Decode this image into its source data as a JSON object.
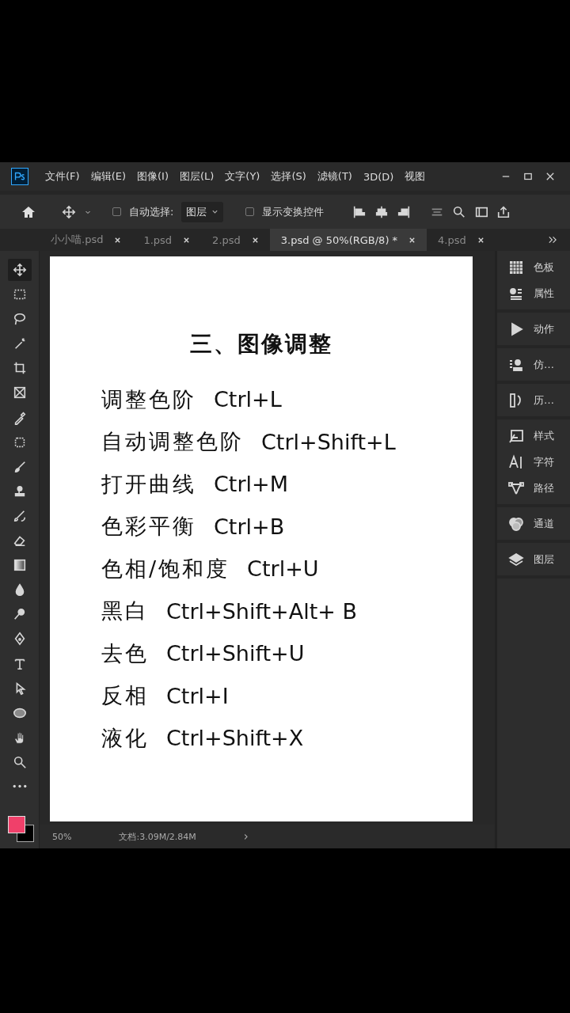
{
  "menu_bar": {
    "items": [
      "文件(F)",
      "编辑(E)",
      "图像(I)",
      "图层(L)",
      "文字(Y)",
      "选择(S)",
      "滤镜(T)",
      "3D(D)",
      "视图"
    ]
  },
  "options_bar": {
    "auto_select": {
      "label": "自动选择:",
      "checked": false
    },
    "target": {
      "value": "图层"
    },
    "show_transform": {
      "label": "显示变换控件",
      "checked": false
    }
  },
  "tabs": [
    {
      "label": "小小喵.psd",
      "selected": false
    },
    {
      "label": "1.psd",
      "selected": false
    },
    {
      "label": "2.psd",
      "selected": false
    },
    {
      "label": "3.psd @ 50%(RGB/8) *",
      "selected": true
    },
    {
      "label": "4.psd",
      "selected": false
    }
  ],
  "tools": [
    {
      "kind": "move",
      "selected": true
    },
    {
      "kind": "marquee",
      "selected": false
    },
    {
      "kind": "lasso",
      "selected": false
    },
    {
      "kind": "wand",
      "selected": false
    },
    {
      "kind": "crop",
      "selected": false
    },
    {
      "kind": "frame",
      "selected": false
    },
    {
      "kind": "eyedropper",
      "selected": false
    },
    {
      "kind": "patch",
      "selected": false
    },
    {
      "kind": "brush",
      "selected": false
    },
    {
      "kind": "stamp",
      "selected": false
    },
    {
      "kind": "history",
      "selected": false
    },
    {
      "kind": "eraser",
      "selected": false
    },
    {
      "kind": "gradient",
      "selected": false
    },
    {
      "kind": "drop",
      "selected": false
    },
    {
      "kind": "dodge",
      "selected": false
    },
    {
      "kind": "pen",
      "selected": false
    },
    {
      "kind": "type",
      "selected": false
    },
    {
      "kind": "arrow",
      "selected": false
    },
    {
      "kind": "ellipse",
      "selected": false
    },
    {
      "kind": "hand",
      "selected": false
    },
    {
      "kind": "zoom",
      "selected": false
    },
    {
      "kind": "more",
      "selected": false
    }
  ],
  "document": {
    "title": "三、图像调整",
    "lines": [
      {
        "name": "调整色阶",
        "shortcut": "Ctrl+L"
      },
      {
        "name": "自动调整色阶",
        "shortcut": "Ctrl+Shift+L"
      },
      {
        "name": "打开曲线",
        "shortcut": "Ctrl+M"
      },
      {
        "name": "色彩平衡",
        "shortcut": "Ctrl+B"
      },
      {
        "name": "色相/饱和度",
        "shortcut": "Ctrl+U"
      },
      {
        "name": "黑白",
        "shortcut": "Ctrl+Shift+Alt+ B"
      },
      {
        "name": "去色",
        "shortcut": "Ctrl+Shift+U"
      },
      {
        "name": "反相",
        "shortcut": "Ctrl+I"
      },
      {
        "name": "液化",
        "shortcut": "Ctrl+Shift+X"
      }
    ]
  },
  "panels": [
    [
      {
        "kind": "swatches",
        "label": "色板"
      },
      {
        "kind": "properties",
        "label": "属性"
      }
    ],
    [
      {
        "kind": "play",
        "label": "动作"
      }
    ],
    [
      {
        "kind": "stamp",
        "label": "仿…"
      }
    ],
    [
      {
        "kind": "history",
        "label": "历…"
      }
    ],
    [
      {
        "kind": "styles",
        "label": "样式"
      },
      {
        "kind": "character",
        "label": "字符"
      },
      {
        "kind": "paths",
        "label": "路径"
      }
    ],
    [
      {
        "kind": "channels",
        "label": "通道"
      }
    ],
    [
      {
        "kind": "layers",
        "label": "图层"
      }
    ]
  ],
  "status_bar": {
    "zoom": "50%",
    "doc_info": "文档:3.09M/2.84M",
    "arrow": "›"
  }
}
